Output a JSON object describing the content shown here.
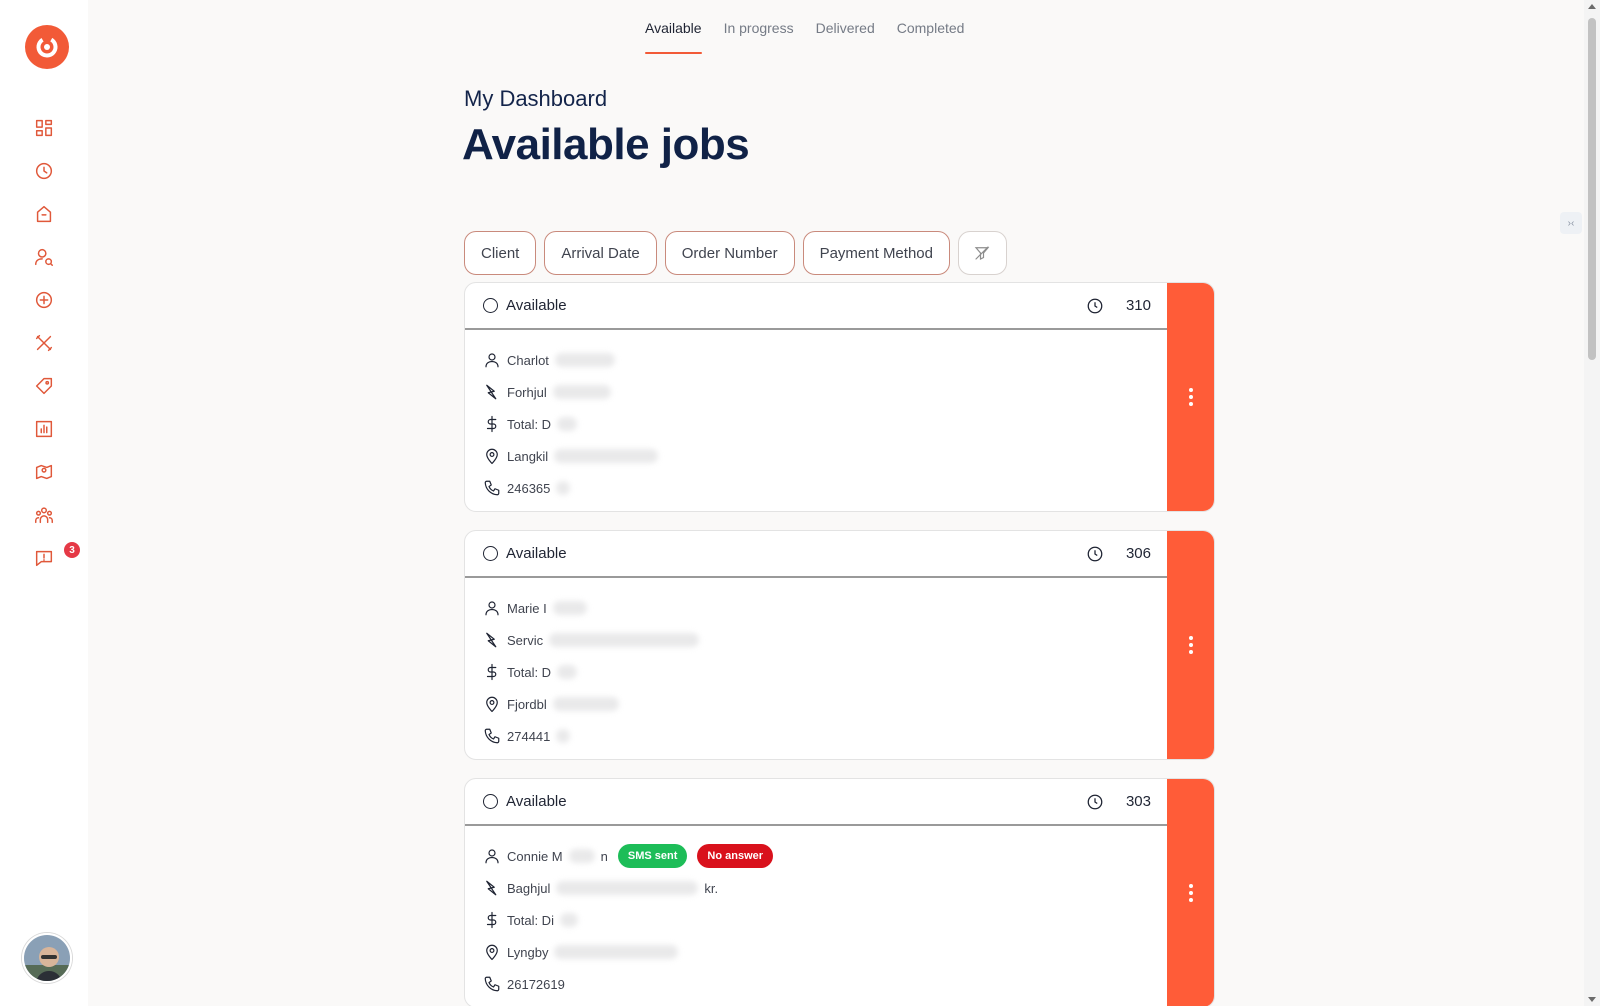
{
  "sidebar": {
    "items": [
      {
        "name": "dashboard-icon"
      },
      {
        "name": "history-icon"
      },
      {
        "name": "store-icon"
      },
      {
        "name": "user-search-icon"
      },
      {
        "name": "add-circle-icon"
      },
      {
        "name": "tools-icon"
      },
      {
        "name": "tag-icon"
      },
      {
        "name": "report-chart-icon"
      },
      {
        "name": "map-pin-icon"
      },
      {
        "name": "team-icon"
      },
      {
        "name": "message-alert-icon",
        "badge": "3"
      }
    ]
  },
  "tabs": [
    {
      "label": "Available",
      "active": true
    },
    {
      "label": "In progress"
    },
    {
      "label": "Delivered"
    },
    {
      "label": "Completed"
    }
  ],
  "header": {
    "subtitle": "My Dashboard",
    "title": "Available jobs"
  },
  "filters": [
    "Client",
    "Arrival Date",
    "Order Number",
    "Payment Method"
  ],
  "jobs": [
    {
      "status": "Available",
      "order": "310",
      "name": "Charlot",
      "service": "Forhjul",
      "total": "Total: D",
      "address": "Langkil",
      "phone": "246365"
    },
    {
      "status": "Available",
      "order": "306",
      "name": "Marie I",
      "service": "Servic",
      "total": "Total: D",
      "address": "Fjordbl",
      "phone": "274441"
    },
    {
      "status": "Available",
      "order": "303",
      "name": "Connie M",
      "name_suffix": "n",
      "tags": {
        "sms": "SMS sent",
        "no_answer": "No answer"
      },
      "service": "Baghjul",
      "service_suffix": "kr.",
      "total": "Total: Di",
      "address": "Lyngby",
      "phone": "26172619"
    }
  ],
  "colors": {
    "accent": "#f25a37",
    "side": "#ff5c38",
    "navy": "#102247"
  }
}
